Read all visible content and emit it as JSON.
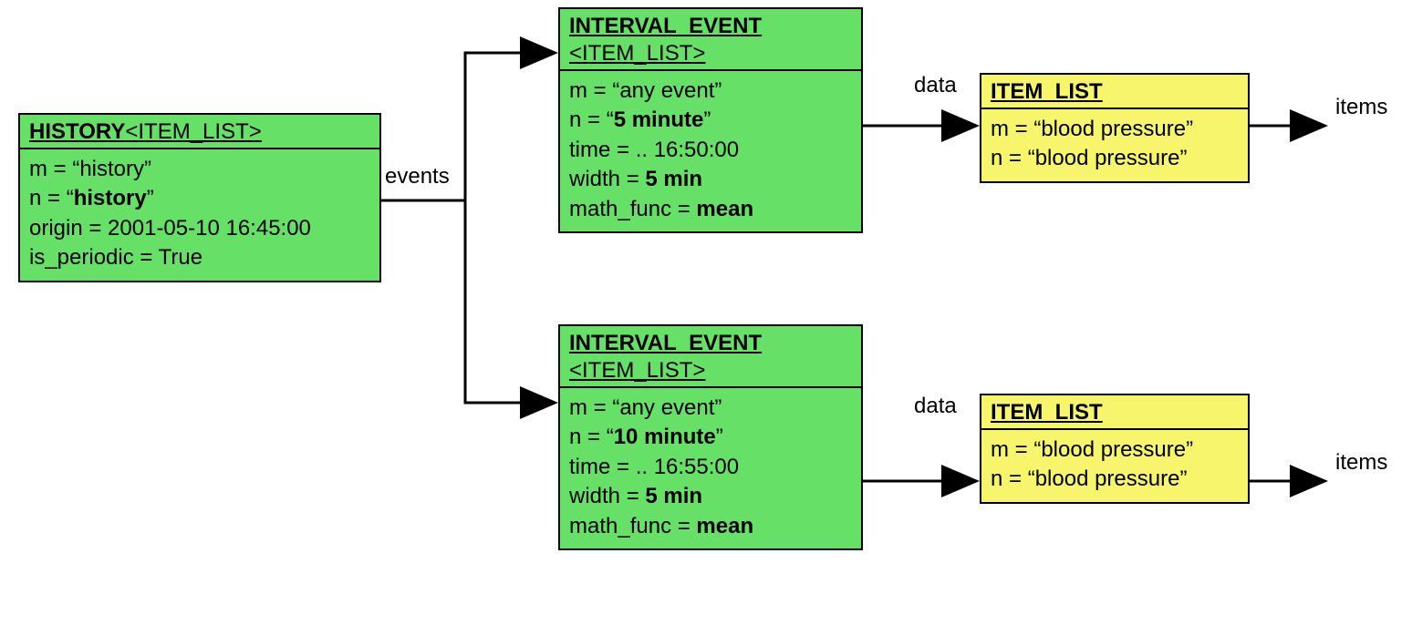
{
  "history": {
    "title_main": "HISTORY",
    "title_generic": "<ITEM_LIST>",
    "m": "m = “history”",
    "n_prefix": "n = “",
    "n_bold": "history",
    "n_suffix": "”",
    "origin": "origin = 2001-05-10 16:45:00",
    "is_periodic": "is_periodic = True"
  },
  "events_label": "events",
  "interval1": {
    "title1": "INTERVAL_EVENT",
    "title2": "<ITEM_LIST>",
    "m": "m = “any event”",
    "n_prefix": "n = “",
    "n_bold": "5 minute",
    "n_suffix": "”",
    "time": "time = .. 16:50:00",
    "width_prefix": "width = ",
    "width_bold": "5 min",
    "mf_prefix": "math_func = ",
    "mf_bold": "mean"
  },
  "interval2": {
    "title1": "INTERVAL_EVENT",
    "title2": "<ITEM_LIST>",
    "m": "m = “any event”",
    "n_prefix": "n = “",
    "n_bold": "10 minute",
    "n_suffix": "”",
    "time": "time = .. 16:55:00",
    "width_prefix": "width = ",
    "width_bold": "5 min",
    "mf_prefix": "math_func = ",
    "mf_bold": "mean"
  },
  "data_label": "data",
  "itemlist1": {
    "title": "ITEM_LIST",
    "m": "m = “blood pressure”",
    "n": "n = “blood pressure”"
  },
  "itemlist2": {
    "title": "ITEM_LIST",
    "m": "m = “blood pressure”",
    "n": "n = “blood pressure”"
  },
  "items_label": "items"
}
